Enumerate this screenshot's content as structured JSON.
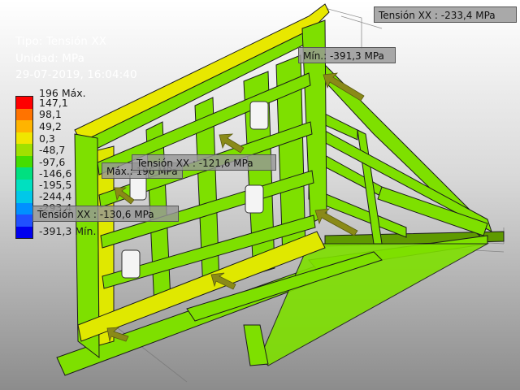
{
  "info": {
    "type_label": "Tipo: Tensión XX",
    "unit_label": "Unidad: MPa",
    "datetime": "29-07-2019, 16:04:40"
  },
  "legend": {
    "colors": [
      "#ff0000",
      "#ff7300",
      "#ffb400",
      "#f0e600",
      "#a0e000",
      "#44dd00",
      "#00e080",
      "#00e0c0",
      "#00c8e8",
      "#0090ff",
      "#2050ff",
      "#0000ee"
    ],
    "labels": [
      "196 Máx.",
      "147,1",
      "98,1",
      "49,2",
      "0,3",
      "-48,7",
      "-97,6",
      "-146,6",
      "-195,5",
      "-244,4",
      "-293,4",
      "-391,3 Mín."
    ]
  },
  "callouts": {
    "max_tension": "Tensión XX : -233,4 MPa",
    "min": "Mín.: -391,3 MPa",
    "tension_mid": "Tensión XX : -121,6 MPa",
    "max_label": "Máx.: 196 MPa",
    "tension_left": "Tensión XX : -130,6 MPa"
  },
  "model": {
    "frame_color": "#7ee000",
    "highlight_color": "#e8e800",
    "edge_color": "#1a1a1a",
    "arrow_color": "#8a8a18"
  }
}
